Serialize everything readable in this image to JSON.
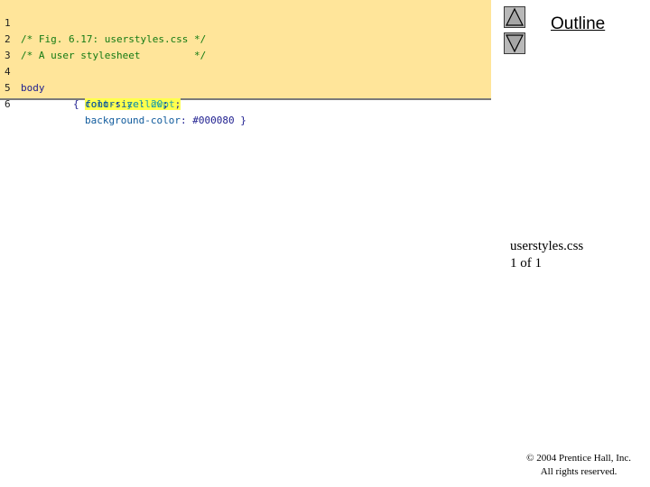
{
  "code": {
    "lines": [
      {
        "number": "1",
        "comment": "/* Fig. 6.17: userstyles.css */"
      },
      {
        "number": "2",
        "comment": "/* A user stylesheet         */"
      },
      {
        "number": "3"
      },
      {
        "number": "4",
        "selector": "body",
        "brace_open": "{ ",
        "property": "font-size",
        "colon": ": ",
        "value": "20pt",
        "end": ";"
      },
      {
        "number": "5",
        "property": "color",
        "colon": ": ",
        "value": "yellow",
        "end": ";"
      },
      {
        "number": "6",
        "property": "background-color",
        "colon": ": ",
        "value": "#000080",
        "end": " }"
      }
    ]
  },
  "nav": {
    "up_icon": "triangle-up-icon",
    "down_icon": "triangle-down-icon"
  },
  "outline": {
    "title": "Outline"
  },
  "file_info": {
    "filename": "userstyles.css",
    "pages": "1 of 1"
  },
  "copyright": {
    "line1": "© 2004 Prentice Hall, Inc.",
    "line2": "All rights reserved."
  },
  "colors": {
    "code_background": "#ffe59a",
    "highlight": "#ffff4d",
    "comment": "#137a13",
    "button_gray": "#b8b8b8"
  }
}
